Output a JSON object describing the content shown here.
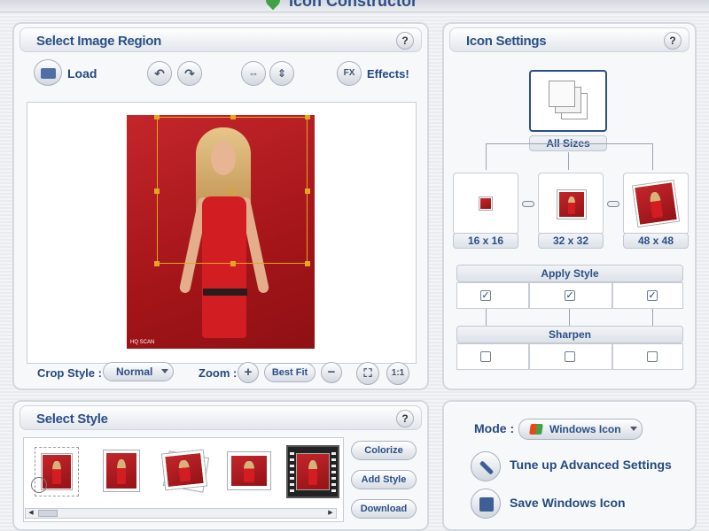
{
  "app": {
    "title": "Icon Constructor"
  },
  "region_panel": {
    "title": "Select Image Region",
    "help": "?",
    "load_label": "Load",
    "effects_badge": "FX",
    "effects_label": "Effects!",
    "watermark": "HQ SCAN",
    "crop_style_label": "Crop Style :",
    "crop_style_value": "Normal",
    "zoom_label": "Zoom :",
    "zoom_in": "+",
    "zoom_out": "−",
    "best_fit": "Best Fit",
    "actual_size": "1:1"
  },
  "settings_panel": {
    "title": "Icon Settings",
    "help": "?",
    "all_sizes": "All Sizes",
    "sizes": [
      "16 x 16",
      "32 x 32",
      "48 x 48"
    ],
    "apply_style": "Apply Style",
    "apply_style_checked": [
      true,
      true,
      true
    ],
    "sharpen": "Sharpen",
    "sharpen_checked": [
      false,
      false,
      false
    ],
    "check_mark": "✓"
  },
  "style_panel": {
    "title": "Select Style",
    "help": "?",
    "colorize": "Colorize",
    "add_style": "Add Style",
    "download": "Download"
  },
  "mode_panel": {
    "mode_label": "Mode :",
    "mode_value": "Windows Icon",
    "tune_label": "Tune up Advanced Settings",
    "save_label": "Save Windows Icon"
  },
  "colors": {
    "accent": "#2b4f86",
    "photo_red": "#b81d22",
    "selection": "#e1a622"
  }
}
